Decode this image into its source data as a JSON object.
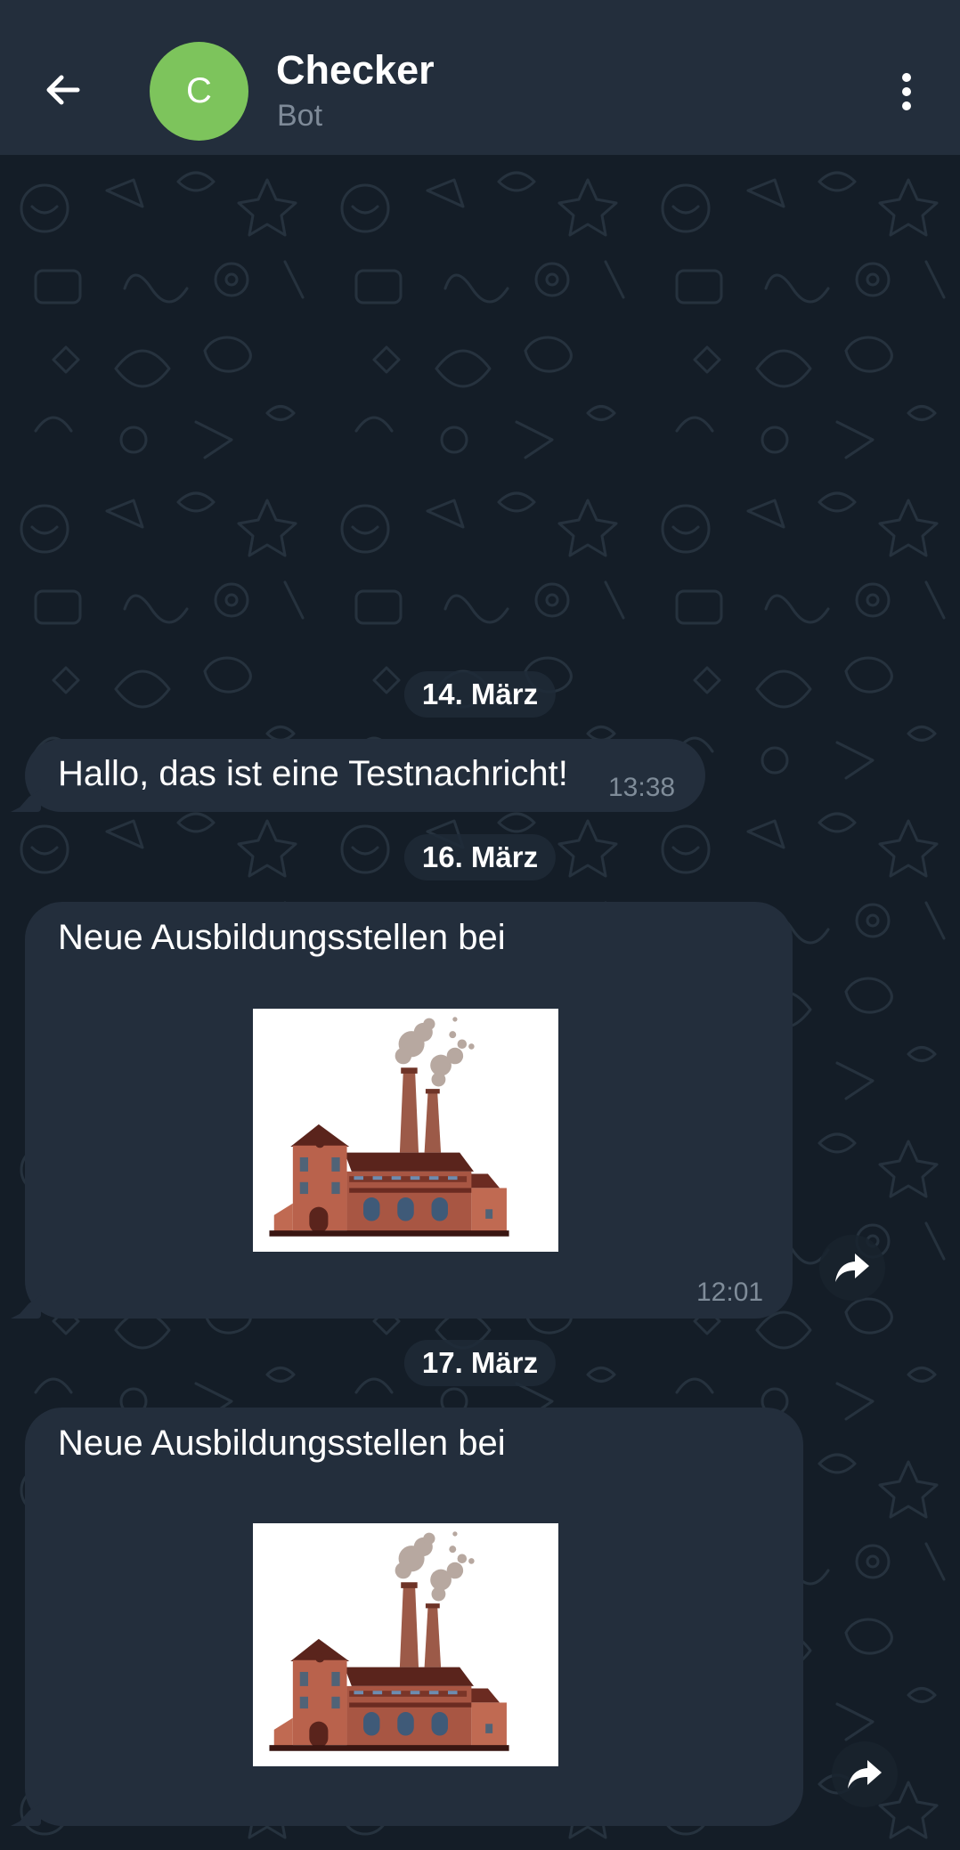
{
  "header": {
    "back_icon": "arrow-left-icon",
    "avatar_letter": "C",
    "avatar_color": "#7dc45c",
    "title": "Checker",
    "subtitle": "Bot",
    "menu_icon": "more-vertical-icon"
  },
  "messages": [
    {
      "date": "14. März",
      "text": "Hallo, das ist eine Testnachricht!",
      "time": "13:38"
    },
    {
      "date": "16. März",
      "text": "Neue Ausbildungsstellen bei",
      "image": "factory-illustration",
      "time": "12:01",
      "share_icon": "share-arrow-icon"
    },
    {
      "date": "17. März",
      "text": "Neue Ausbildungsstellen bei",
      "image": "factory-illustration",
      "share_icon": "share-arrow-icon"
    }
  ],
  "theme": {
    "header_bg": "#232e3c",
    "bubble_bg": "#232e3c",
    "chat_bg": "#141d27",
    "time_color": "#7f8c99"
  }
}
